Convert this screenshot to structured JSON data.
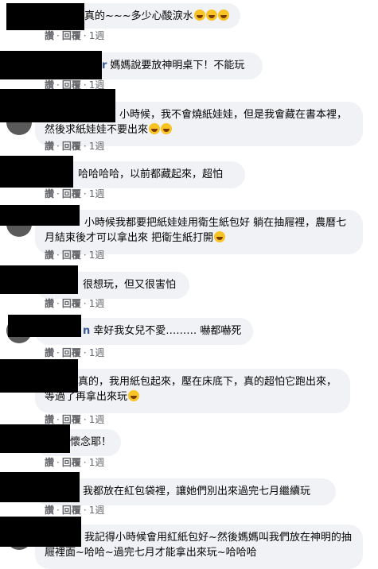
{
  "actions": {
    "like": "讚",
    "reply": "回覆",
    "time": "1週"
  },
  "comments": [
    {
      "author": "",
      "text": "真的~~~多少心酸淚水",
      "emoji_count": 3
    },
    {
      "author": "r",
      "text": "媽媽說要放神明桌下！不能玩",
      "emoji_count": 0
    },
    {
      "author": "",
      "text": "小時候，我不會燒紙娃娃，但是我會藏在書本裡，然後求紙娃娃不要出來",
      "emoji_count": 2
    },
    {
      "author": "",
      "text": "哈哈哈哈，以前都藏起來，超怕",
      "emoji_count": 0
    },
    {
      "author": "",
      "text": "小時候我都要把紙娃娃用衛生紙包好 躺在抽屜裡，農曆七月結束後才可以拿出來 把衛生紙打開",
      "emoji_count": 1
    },
    {
      "author": "",
      "text": "很想玩，但又很害怕",
      "emoji_count": 0
    },
    {
      "author": "n",
      "text": "幸好我女兒不愛……… 嚇都嚇死",
      "emoji_count": 0
    },
    {
      "author": "",
      "text": "真的，我用紙包起來，壓在床底下，真的超怕它跑出來，等過了再拿出來玩",
      "emoji_count": 1
    },
    {
      "author": "",
      "text": "懷念耶！",
      "emoji_count": 0
    },
    {
      "author": "",
      "text": "我都放在紅包袋裡，讓她們別出來過完七月繼續玩",
      "emoji_count": 0
    },
    {
      "author": "",
      "text": "我記得小時候會用紅紙包好~然後媽媽叫我們放在神明的抽屜裡面~哈哈~過完七月才能拿出來玩~哈哈哈",
      "emoji_count": 0
    }
  ]
}
